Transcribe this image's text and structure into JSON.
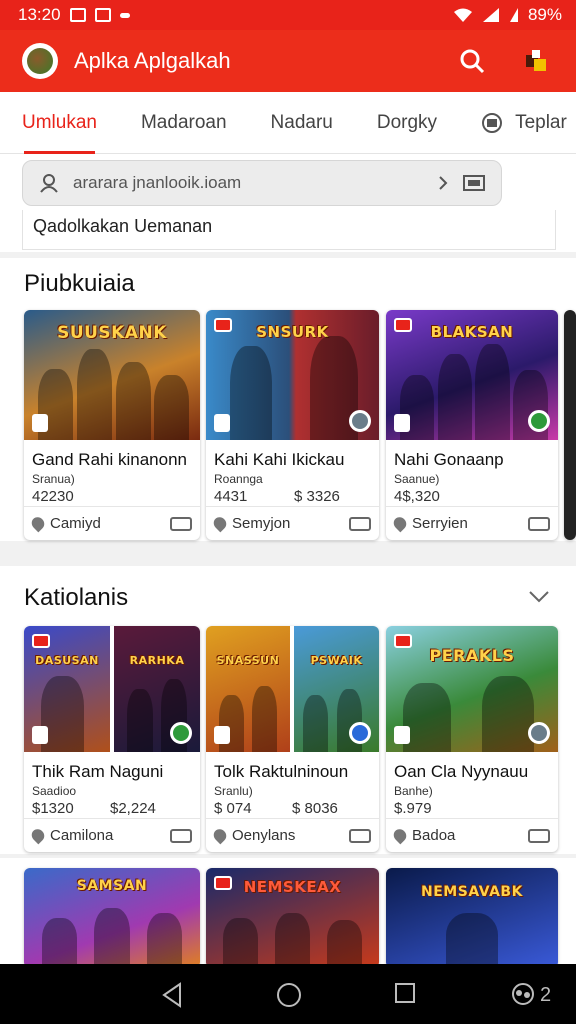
{
  "status_bar": {
    "time": "13:20",
    "battery": "89%"
  },
  "app": {
    "title": "Aplka Aplgalkah",
    "logo_icon": "app-logo-icon",
    "accent": "#e8231a"
  },
  "tabs": [
    {
      "label": "Umlukan",
      "active": true
    },
    {
      "label": "Madaroan"
    },
    {
      "label": "Nadaru"
    },
    {
      "label": "Dorgky"
    },
    {
      "label": "Teplar",
      "icon": "globe-icon"
    }
  ],
  "search": {
    "value": "ararara jnanlooik.ioam",
    "suggestion": "Qadolkakan Uemanan"
  },
  "sections": [
    {
      "title": "Piubkuiaia",
      "cards": [
        {
          "art_text": "SUUSKANK",
          "title": "Gand Rahi kinanonn",
          "subtitle": "Sranua)",
          "price": "42230",
          "price2": "",
          "footer": "Camiyd"
        },
        {
          "art_text": "SNSURK",
          "title": "Kahi Kahi Ikickau",
          "subtitle": "Roannga",
          "price": "4431",
          "price2": "$ 3326",
          "footer": "Semyjon"
        },
        {
          "art_text": "BLAKSAN",
          "title": "Nahi Gonaanp",
          "subtitle": "Saanue)",
          "price": "4$,320",
          "price2": "",
          "footer": "Serryien"
        }
      ]
    },
    {
      "title": "Katiolanis",
      "cards": [
        {
          "art_text": "DASUSAN",
          "art_text_b": "RARHKA",
          "title": "Thik Ram Naguni",
          "subtitle": "Saadioo",
          "price": "$1320",
          "price2": "$2,224",
          "footer": "Camilona"
        },
        {
          "art_text": "SNASSUN",
          "art_text_b": "PSWAIK",
          "title": "Tolk Raktulninoun",
          "subtitle": "Sranlu)",
          "price": "$ 074",
          "price2": "$ 8036",
          "footer": "Oenylans"
        },
        {
          "art_text": "PERAKLS",
          "title": "Oan Cla Nyynauu",
          "subtitle": "Banhe)",
          "price": "$.979",
          "price2": "",
          "footer": "Badoa"
        }
      ]
    },
    {
      "cards": [
        {
          "art_text": "SAMSAN"
        },
        {
          "art_text": "NEMSKEAX"
        },
        {
          "art_text": "NEMSAVABK"
        }
      ]
    }
  ],
  "nav": {
    "count": "2"
  }
}
